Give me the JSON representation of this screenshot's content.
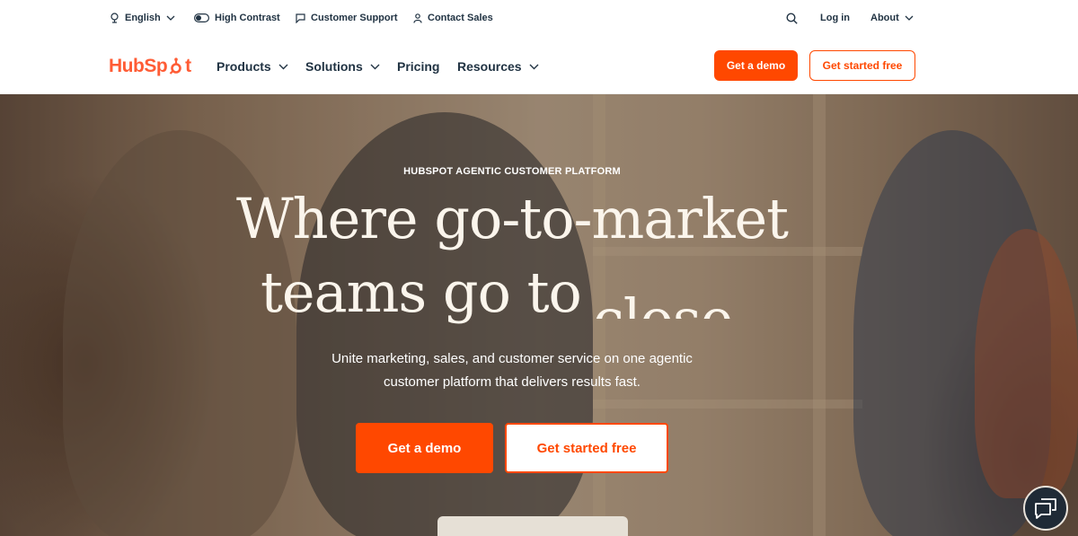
{
  "utility_bar": {
    "language_label": "English",
    "contrast_label": "High Contrast",
    "support_label": "Customer Support",
    "sales_label": "Contact Sales",
    "login_label": "Log in",
    "about_label": "About"
  },
  "nav": {
    "logo_text_before": "HubSp",
    "logo_text_after": "t",
    "items": [
      {
        "label": "Products",
        "has_dropdown": true
      },
      {
        "label": "Solutions",
        "has_dropdown": true
      },
      {
        "label": "Pricing",
        "has_dropdown": false
      },
      {
        "label": "Resources",
        "has_dropdown": true
      }
    ],
    "demo_label": "Get a demo",
    "free_label": "Get started free"
  },
  "hero": {
    "eyebrow": "HUBSPOT AGENTIC CUSTOMER PLATFORM",
    "headline_line1": "Where go-to-market",
    "headline_line2": "teams go to",
    "headline_rotating_word": "close",
    "subtitle": "Unite marketing, sales, and customer service on one agentic customer platform that delivers results fast.",
    "demo_label": "Get a demo",
    "free_label": "Get started free"
  },
  "chat": {
    "icon": "chat-icon"
  },
  "colors": {
    "accent": "#ff4800",
    "logo": "#ff5c35",
    "text": "#213343",
    "headline": "#fbf5ec",
    "chat_bg": "#1f2a36"
  }
}
